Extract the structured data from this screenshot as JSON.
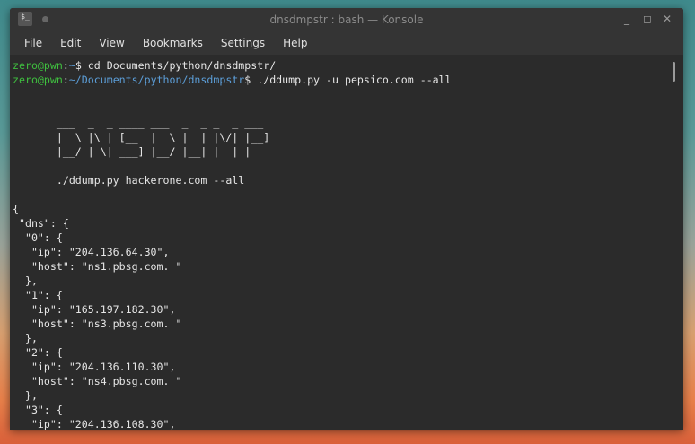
{
  "window": {
    "title": "dnsdmpstr : bash — Konsole",
    "icon": "terminal-icon",
    "controls": [
      "minimize-icon",
      "maximize-icon",
      "close-icon"
    ]
  },
  "menu": [
    "File",
    "Edit",
    "View",
    "Bookmarks",
    "Settings",
    "Help"
  ],
  "prompt": {
    "user": "zero@pwn",
    "sep": ":",
    "path1": "~",
    "cmd1": "$ cd Documents/python/dnsdmpstr/",
    "path2": "~/Documents/python/dnsdmpstr",
    "cmd2": "$ ./ddump.py -u pepsico.com --all"
  },
  "output": [
    "",
    "",
    "       ___  _  _ ____ ___  _  _ _  _ ___",
    "       |  \\ |\\ | [__  |  \\ |  | |\\/| |__]",
    "       |__/ | \\| ___] |__/ |__| |  | |",
    "",
    "       ./ddump.py hackerone.com --all",
    "",
    "{",
    " \"dns\": {",
    "  \"0\": {",
    "   \"ip\": \"204.136.64.30\",",
    "   \"host\": \"ns1.pbsg.com. \"",
    "  },",
    "  \"1\": {",
    "   \"ip\": \"165.197.182.30\",",
    "   \"host\": \"ns3.pbsg.com. \"",
    "  },",
    "  \"2\": {",
    "   \"ip\": \"204.136.110.30\",",
    "   \"host\": \"ns4.pbsg.com. \"",
    "  },",
    "  \"3\": {",
    "   \"ip\": \"204.136.108.30\","
  ]
}
